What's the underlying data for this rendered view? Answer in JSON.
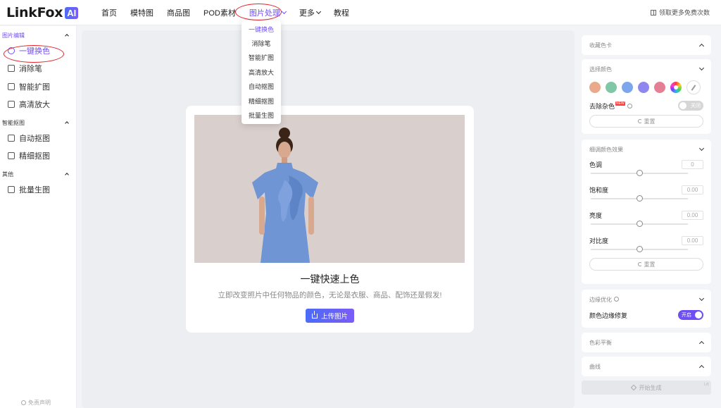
{
  "logo": {
    "text": "LinkFox",
    "badge": "AI"
  },
  "nav": [
    {
      "label": "首页"
    },
    {
      "label": "模特图"
    },
    {
      "label": "商品图"
    },
    {
      "label": "POD素材"
    },
    {
      "label": "图片处理"
    },
    {
      "label": "更多"
    },
    {
      "label": "教程"
    }
  ],
  "header_right": {
    "label": "领取更多免费次数"
  },
  "dropdown": [
    "一键换色",
    "消除笔",
    "智能扩图",
    "高清放大",
    "自动抠图",
    "精细抠图",
    "批量生图"
  ],
  "sidebar": {
    "groups": [
      {
        "label": "图片编辑",
        "items": [
          "一键换色",
          "消除笔",
          "智能扩图",
          "高清放大"
        ]
      },
      {
        "label": "智能抠图",
        "items": [
          "自动抠图",
          "精细抠图"
        ]
      },
      {
        "label": "其他",
        "items": [
          "批量生图"
        ]
      }
    ],
    "footer": "免责声明"
  },
  "main": {
    "title": "一键快速上色",
    "subtitle": "立即改变照片中任何物品的颜色，无论是衣服、商品、配饰还是假发!",
    "upload_label": "上传图片"
  },
  "panel": {
    "color_card": "收藏色卡",
    "select_color": "选择颜色",
    "swatches": [
      "#e9a98a",
      "#7fc7a6",
      "#7ea6ec",
      "#8f86f0",
      "#e47f94"
    ],
    "remove_noise": "去除杂色",
    "new_badge": "NEW",
    "toggle_off": "关闭",
    "reset": "重置",
    "fine_tune": "细调颜色效果",
    "sliders": [
      {
        "label": "色调",
        "value": "0",
        "position": 0.5
      },
      {
        "label": "饱和度",
        "value": "0.00",
        "position": 0.5
      },
      {
        "label": "亮度",
        "value": "0.00",
        "position": 0.5
      },
      {
        "label": "对比度",
        "value": "0.00",
        "position": 0.5
      }
    ],
    "reset2": "重置",
    "edge_opt": "边缘优化",
    "edge_repair": "颜色边缘修复",
    "toggle_on": "开启",
    "color_balance": "色彩平衡",
    "curves": "曲线",
    "generate": "开始生成",
    "generate_badge": "1点"
  },
  "colors": {
    "accent": "#6f4ef2",
    "annotation": "#e2232a"
  }
}
